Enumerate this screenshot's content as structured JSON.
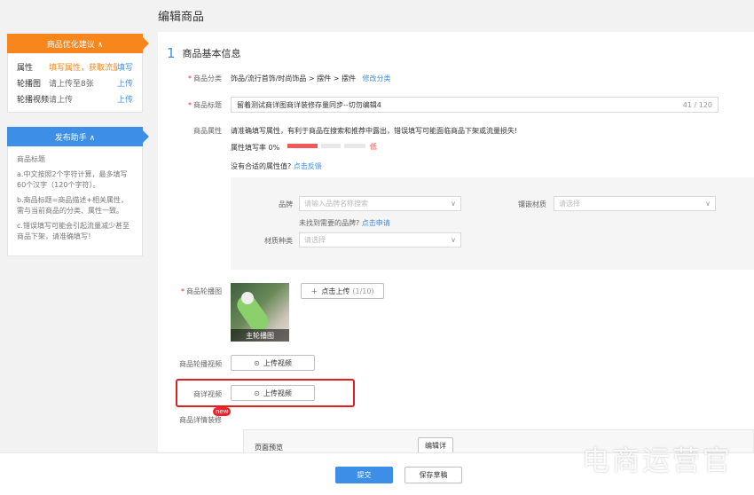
{
  "page": {
    "title": "编辑商品"
  },
  "sidebar": {
    "opt_panel": {
      "title": "商品优化建议 ∧",
      "rows": [
        {
          "key": "属性",
          "value": "填写属性，获取流量",
          "action": "填写"
        },
        {
          "key": "轮播图",
          "value": "请上传至8张",
          "action": "上传"
        },
        {
          "key": "轮播视频",
          "value": "请上传",
          "action": "上传"
        }
      ]
    },
    "helper_panel": {
      "title": "发布助手 ∧",
      "heading": "商品标题",
      "tips": [
        "a.中文按照2个字符计算，最多填写60个汉字（120个字符）。",
        "b.商品标题=商品描述+相关属性，需与当前商品的分类、属性一致。",
        "c.错误填写可能会引起流量减少甚至商品下架，请准确填写！"
      ]
    }
  },
  "main": {
    "section": {
      "num": "1",
      "title": "商品基本信息"
    },
    "category": {
      "label": "商品分类",
      "path": "饰品/流行首饰/时尚饰品 > 摆件 > 摆件",
      "action": "修改分类"
    },
    "title_field": {
      "label": "商品标题",
      "value": "留着测试商详图商详装修存量同步--切勿编辑4",
      "count": "41 / 120"
    },
    "attrs": {
      "label": "商品属性",
      "hint": "请准确填写属性，有利于商品在搜索和推荐中露出，错误填写可能面临商品下架或流量损失!",
      "rate_label": "属性填写率 0%",
      "rate_value": 0,
      "rate_level": "低",
      "feedback_q": "没有合适的属性值?",
      "feedback_link": "点击反馈",
      "brand": {
        "label": "品牌",
        "placeholder": "请输入品牌名称搜索"
      },
      "brand_missing": "未找到需要的品牌?",
      "brand_apply": "点击申请",
      "inlay": {
        "label": "镶嵌材质",
        "placeholder": "请选择"
      },
      "material": {
        "label": "材质种类",
        "placeholder": "请选择"
      }
    },
    "carousel": {
      "label": "商品轮播图",
      "thumb_caption": "主轮播图",
      "upload": "点击上传",
      "upload_count": "(1/10)"
    },
    "carousel_video": {
      "label": "商品轮播视频",
      "button": "上传视频"
    },
    "detail_video": {
      "label": "商详视频",
      "button": "上传视频"
    },
    "detail_decor": {
      "label": "商品详情装修",
      "badge": "new",
      "preview": "页面预览",
      "edit": "编辑详"
    }
  },
  "footer": {
    "submit": "提交",
    "draft": "保存草稿"
  },
  "watermark": "电商运营官",
  "colors": {
    "accent": "#3c8ee6",
    "warn": "#f7861c",
    "highlight_border": "#e0201f"
  }
}
